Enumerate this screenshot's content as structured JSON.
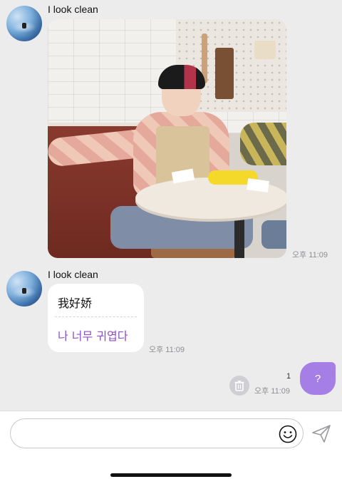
{
  "messages": [
    {
      "sender": "I look clean",
      "type": "image",
      "time": "오후 11:09"
    },
    {
      "sender": "I look clean",
      "type": "text",
      "text_original": "我好娇",
      "text_translated": "나 너무 귀엽다",
      "time": "오후 11:09"
    }
  ],
  "my_message": {
    "text": "?",
    "unread_count": "1",
    "time": "오후 11:09"
  },
  "composer": {
    "placeholder": "",
    "value": ""
  },
  "icons": {
    "avatar": "avatar-icon",
    "trash": "trash-icon",
    "emoji": "smiley-icon",
    "send": "send-icon"
  },
  "colors": {
    "background": "#ececec",
    "my_bubble": "#a57ee6",
    "translation_text": "#8e4fc9",
    "timestamp": "#8e8e93"
  }
}
